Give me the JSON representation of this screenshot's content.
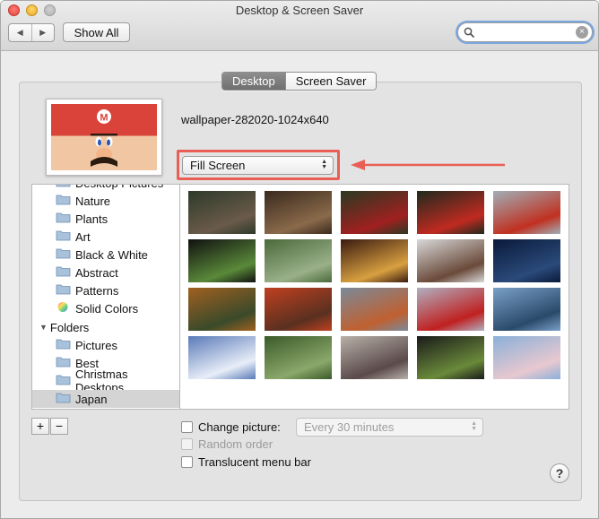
{
  "window": {
    "title": "Desktop & Screen Saver"
  },
  "toolbar": {
    "show_all": "Show All",
    "search_placeholder": ""
  },
  "tabs": [
    {
      "label": "Desktop",
      "active": true
    },
    {
      "label": "Screen Saver",
      "active": false
    }
  ],
  "wallpaper": {
    "name": "wallpaper-282020-1024x640"
  },
  "fill_mode": {
    "selected": "Fill Screen"
  },
  "sidebar": {
    "partial_top": "Desktop Pictures",
    "apple_items": [
      "Nature",
      "Plants",
      "Art",
      "Black & White",
      "Abstract",
      "Patterns",
      "Solid Colors"
    ],
    "folders_header": "Folders",
    "folder_items": [
      "Pictures",
      "Best",
      "Christmas Desktops",
      "Japan"
    ],
    "selected": "Japan"
  },
  "options": {
    "change_picture": "Change picture:",
    "interval": "Every 30 minutes",
    "random_order": "Random order",
    "translucent_menu_bar": "Translucent menu bar"
  },
  "buttons": {
    "add": "+",
    "remove": "−",
    "help": "?"
  },
  "colors": {
    "highlight": "#ea5f55",
    "selected_row": "#d4d4d4",
    "search_focus": "#7aa7e0"
  },
  "thumbnails": [
    {
      "name": "temple-pond",
      "c1": "#2e3a2a",
      "c2": "#6a5a4a"
    },
    {
      "name": "wooden-corridor",
      "c1": "#3a2a1e",
      "c2": "#8a6a4a"
    },
    {
      "name": "red-umbrella",
      "c1": "#2a3a22",
      "c2": "#a02020"
    },
    {
      "name": "torii-gate",
      "c1": "#1e2a1e",
      "c2": "#c02a20"
    },
    {
      "name": "pagoda-forest",
      "c1": "#a0b0b8",
      "c2": "#c03020"
    },
    {
      "name": "window-garden",
      "c1": "#101010",
      "c2": "#5a8a3a"
    },
    {
      "name": "moss-statue",
      "c1": "#4a6a3a",
      "c2": "#9ab08a"
    },
    {
      "name": "lanterns",
      "c1": "#3a1a10",
      "c2": "#d8a040"
    },
    {
      "name": "snow-pagoda",
      "c1": "#d8d8d8",
      "c2": "#6a4a3a"
    },
    {
      "name": "night-lake",
      "c1": "#0a1a3a",
      "c2": "#2a4a7a"
    },
    {
      "name": "autumn-shrine",
      "c1": "#a06020",
      "c2": "#3a4a2a"
    },
    {
      "name": "autumn-steps",
      "c1": "#c04020",
      "c2": "#5a3020"
    },
    {
      "name": "autumn-river",
      "c1": "#7a8a9a",
      "c2": "#c06030"
    },
    {
      "name": "festival-float",
      "c1": "#b0b0c0",
      "c2": "#c02020"
    },
    {
      "name": "mountain-lake",
      "c1": "#7aa0c8",
      "c2": "#2a4a6a"
    },
    {
      "name": "mount-fuji",
      "c1": "#5a7ab8",
      "c2": "#e8eef8"
    },
    {
      "name": "bamboo-path",
      "c1": "#3a5a2a",
      "c2": "#8aa86a"
    },
    {
      "name": "foggy-station",
      "c1": "#b8b0a8",
      "c2": "#5a4a4a"
    },
    {
      "name": "round-window",
      "c1": "#1a1a1a",
      "c2": "#6a8a3a"
    },
    {
      "name": "cherry-temple",
      "c1": "#8ab0d8",
      "c2": "#e8c8d0"
    }
  ]
}
